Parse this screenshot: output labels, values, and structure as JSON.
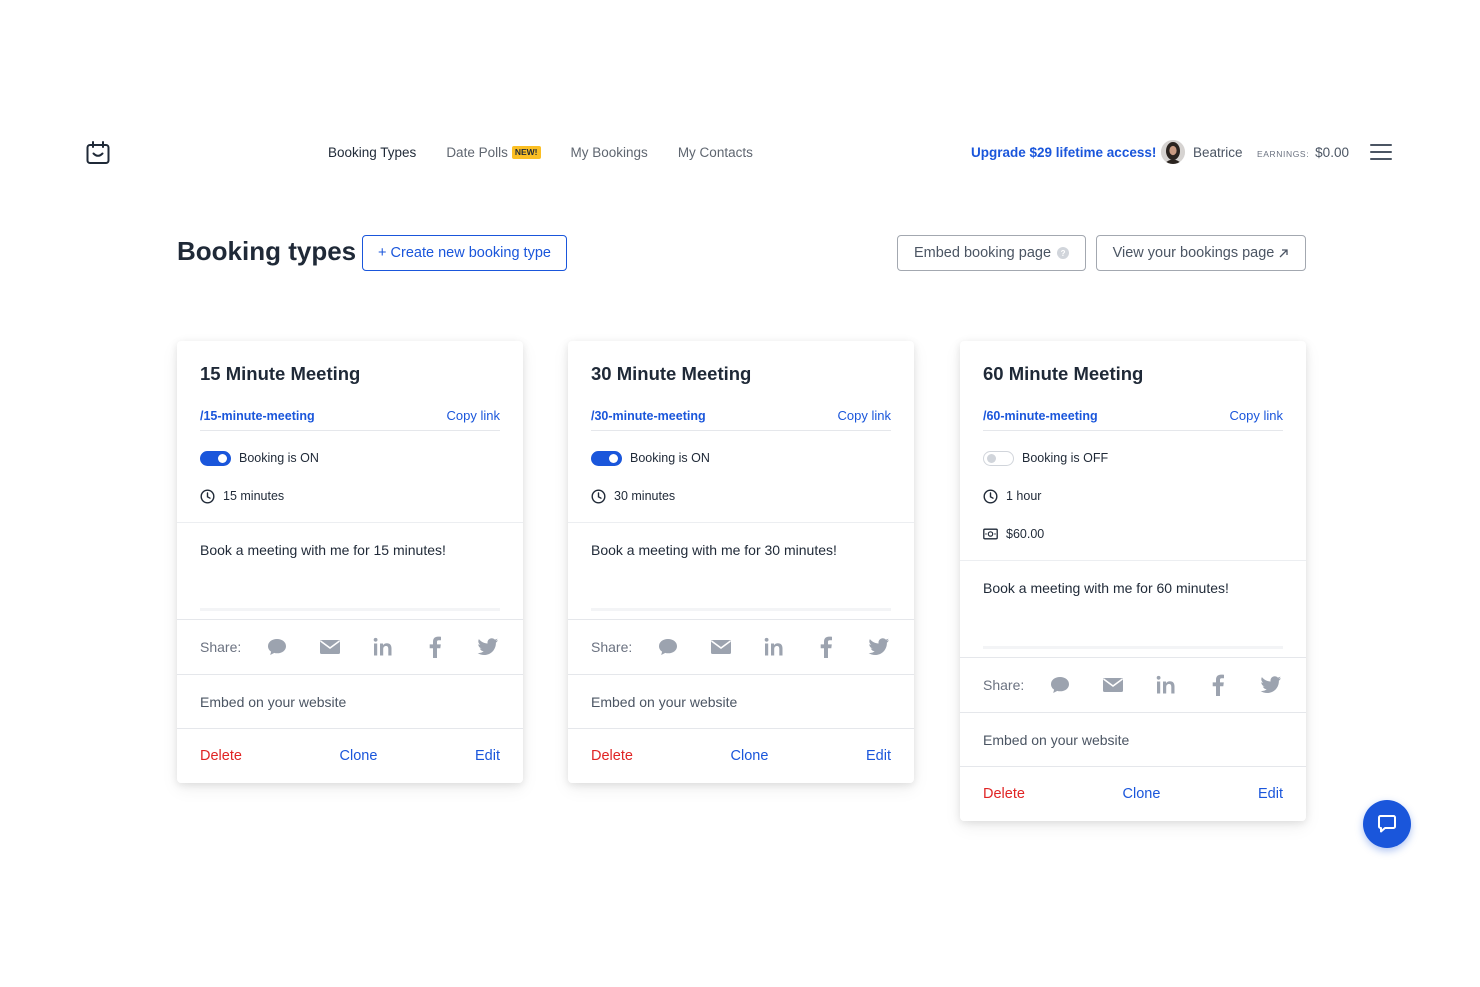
{
  "header": {
    "logo_icon": "calendar-smile-icon",
    "nav": [
      {
        "label": "Booking Types",
        "active": true
      },
      {
        "label": "Date Polls",
        "badge": "NEW!"
      },
      {
        "label": "My Bookings"
      },
      {
        "label": "My Contacts"
      }
    ],
    "upgrade_label": "Upgrade $29 lifetime access!",
    "user_name": "Beatrice",
    "earnings_label": "EARNINGS:",
    "earnings_value": "$0.00",
    "menu_icon": "hamburger-menu-icon"
  },
  "page": {
    "title": "Booking types",
    "create_label": "+ Create new booking type",
    "embed_page_label": "Embed booking page",
    "embed_help": "?",
    "view_page_label": "View your bookings page",
    "view_page_icon": "external-link-arrow-icon"
  },
  "cards": [
    {
      "title": "15 Minute Meeting",
      "slug": "/15-minute-meeting",
      "copy_label": "Copy link",
      "booking_status": "Booking is ON",
      "booking_on": true,
      "duration": "15 minutes",
      "description": "Book a meeting with me for 15 minutes!",
      "share_label": "Share:",
      "embed_label": "Embed on your website",
      "delete_label": "Delete",
      "clone_label": "Clone",
      "edit_label": "Edit"
    },
    {
      "title": "30 Minute Meeting",
      "slug": "/30-minute-meeting",
      "copy_label": "Copy link",
      "booking_status": "Booking is ON",
      "booking_on": true,
      "duration": "30 minutes",
      "description": "Book a meeting with me for 30 minutes!",
      "share_label": "Share:",
      "embed_label": "Embed on your website",
      "delete_label": "Delete",
      "clone_label": "Clone",
      "edit_label": "Edit"
    },
    {
      "title": "60 Minute Meeting",
      "slug": "/60-minute-meeting",
      "copy_label": "Copy link",
      "booking_status": "Booking is OFF",
      "booking_on": false,
      "duration": "1 hour",
      "price": "$60.00",
      "description": "Book a meeting with me for 60 minutes!",
      "share_label": "Share:",
      "embed_label": "Embed on your website",
      "delete_label": "Delete",
      "clone_label": "Clone",
      "edit_label": "Edit"
    }
  ],
  "share_icons": [
    "chat-bubble-icon",
    "email-icon",
    "linkedin-icon",
    "facebook-icon",
    "twitter-icon"
  ],
  "chat_widget_icon": "chat-bubble-icon",
  "colors": {
    "primary": "#1a56db",
    "danger": "#e02424",
    "badge": "#fbbf24",
    "text": "#1f2937",
    "muted": "#6b7280"
  }
}
